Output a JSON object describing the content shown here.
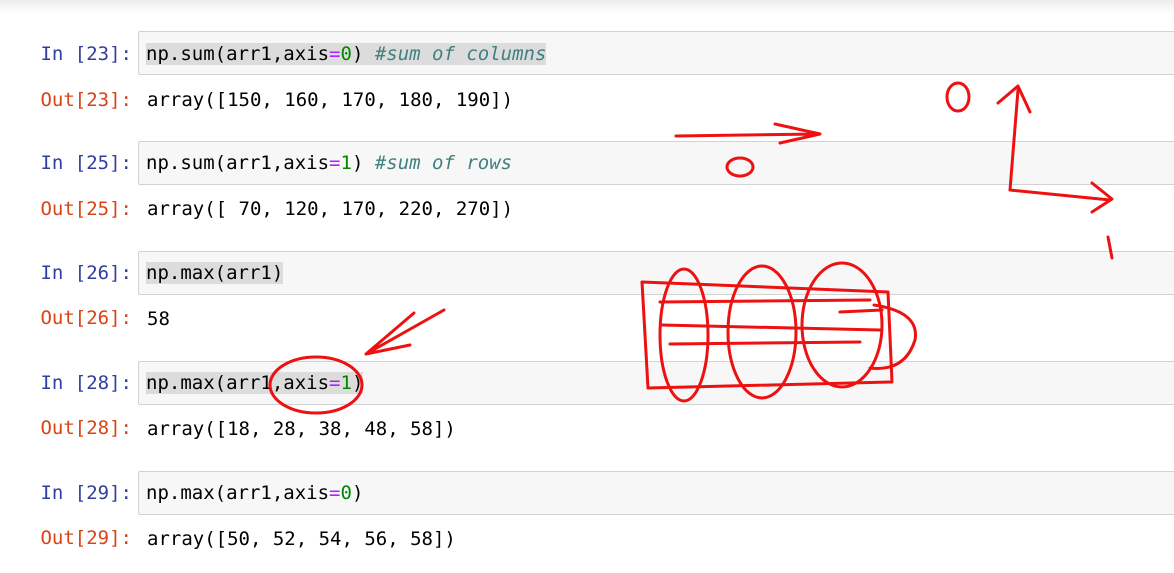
{
  "cells": [
    {
      "in_prompt": "In [23]:",
      "code": {
        "fn": "np.sum(arr1,axis",
        "eq": "=",
        "num": "0",
        "close": ") ",
        "comment": "#sum of columns"
      },
      "out_prompt": "Out[23]:",
      "output": "array([150, 160, 170, 180, 190])"
    },
    {
      "in_prompt": "In [25]:",
      "code": {
        "fn": "np.sum(arr1,axis",
        "eq": "=",
        "num": "1",
        "close": ") ",
        "comment": "#sum of rows"
      },
      "out_prompt": "Out[25]:",
      "output": "array([ 70, 120, 170, 220, 270])"
    },
    {
      "in_prompt": "In [26]:",
      "code": {
        "text": "np.max(arr1)"
      },
      "out_prompt": "Out[26]:",
      "output": "58"
    },
    {
      "in_prompt": "In [28]:",
      "code": {
        "fn": "np.max(arr1,axis",
        "eq": "=",
        "num": "1",
        "close": ")"
      },
      "out_prompt": "Out[28]:",
      "output": "array([18, 28, 38, 48, 58])"
    },
    {
      "in_prompt": "In [29]:",
      "code": {
        "fn": "np.max(arr1,axis",
        "eq": "=",
        "num": "0",
        "close": ")"
      },
      "out_prompt": "Out[29]:",
      "output": "array([50, 52, 54, 56, 58])"
    }
  ],
  "annotations": {
    "label_zero_top": "0",
    "label_zero_mid": "0",
    "label_one_right": "1",
    "color": "#ee1111"
  }
}
